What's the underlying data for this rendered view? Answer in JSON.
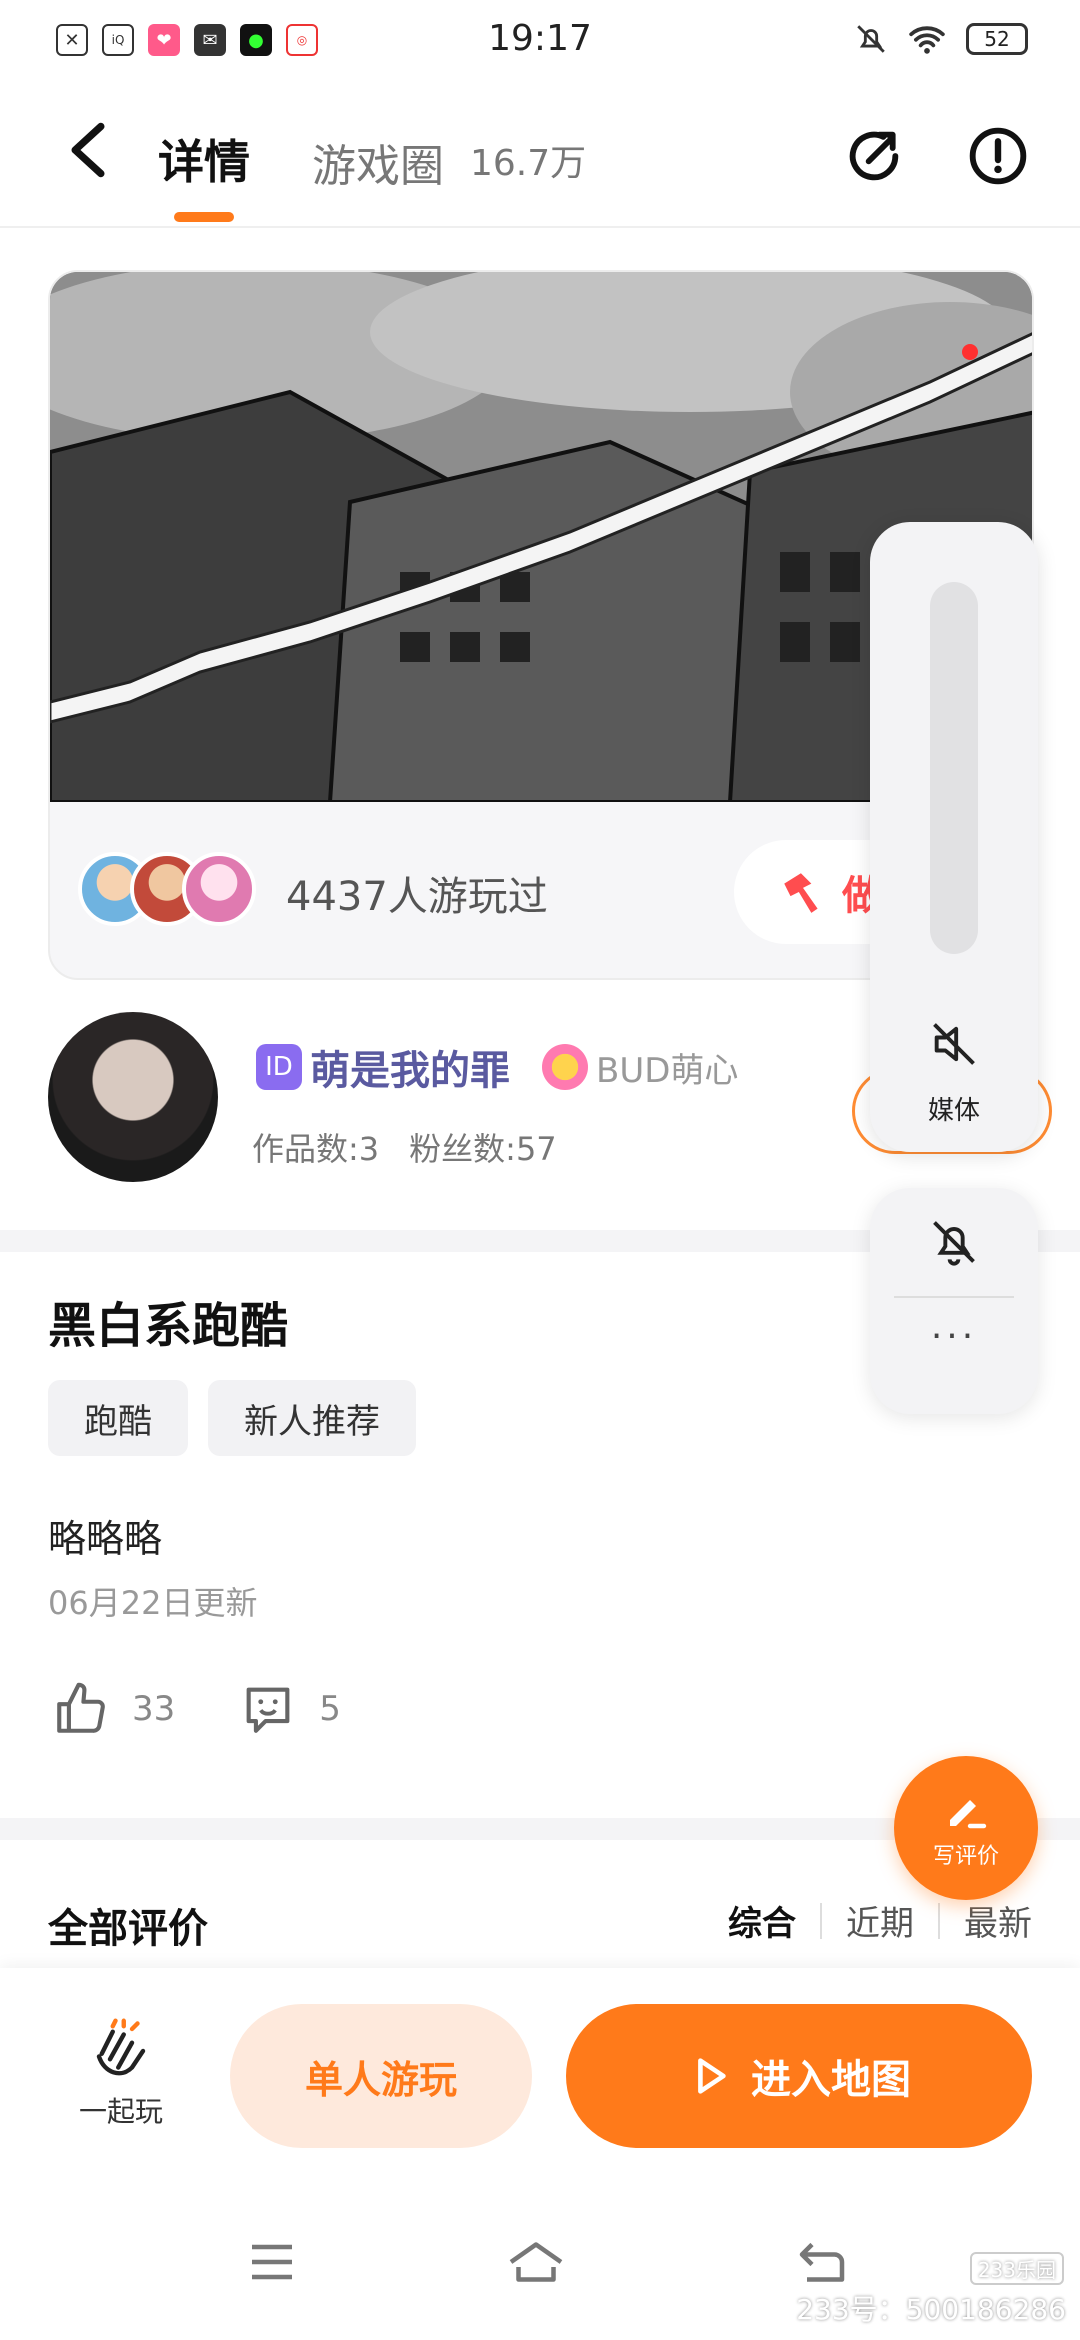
{
  "status_bar": {
    "time": "19:17",
    "battery": "52"
  },
  "header": {
    "tab_detail": "详情",
    "tab_circle": "游戏圈",
    "circle_count": "16.7万"
  },
  "media_card": {
    "players_text": "4437人游玩过",
    "make_button_label": "做"
  },
  "author": {
    "name": "萌是我的罪",
    "id_badge": "ID",
    "bud_label": "BUD萌心",
    "works": "作品数:3",
    "fans": "粉丝数:57"
  },
  "game": {
    "title": "黑白系跑酷",
    "tags": [
      "跑酷",
      "新人推荐"
    ],
    "description": "略略略",
    "updated": "06月22日更新",
    "likes": "33",
    "comments": "5"
  },
  "reviews": {
    "title": "全部评价",
    "sorts": [
      "综合",
      "近期",
      "最新"
    ]
  },
  "write_review_label": "写评价",
  "volume_panel": {
    "label": "媒体",
    "level_fraction": 0,
    "dots": "···"
  },
  "bottom_bar": {
    "together_label": "一起玩",
    "solo_label": "单人游玩",
    "enter_label": "进入地图"
  },
  "watermark": {
    "badge": "233乐园",
    "text": "233号：500186286"
  },
  "colors": {
    "accent": "#ff7a1a",
    "accent_light": "#fee9dc",
    "author_name": "#5a5aa0"
  }
}
